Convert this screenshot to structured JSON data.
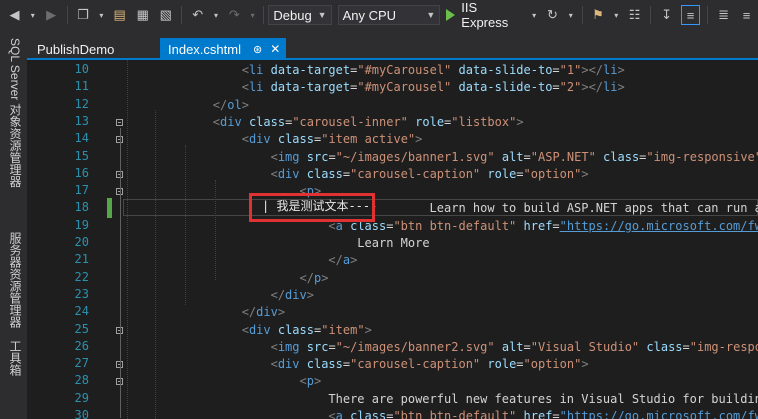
{
  "toolbar": {
    "config": "Debug",
    "platform": "Any CPU",
    "run_label": "IIS Express"
  },
  "sidebar": {
    "tabs": [
      "SQL Server 对象资源管理器",
      "服务器资源管理器",
      "工具箱"
    ]
  },
  "tabs": [
    {
      "label": "PublishDemo",
      "active": false
    },
    {
      "label": "Index.cshtml",
      "active": true
    }
  ],
  "editor": {
    "line_numbers": [
      "10",
      "11",
      "12",
      "13",
      "14",
      "15",
      "16",
      "17",
      "18",
      "19",
      "20",
      "21",
      "22",
      "23",
      "24",
      "25",
      "26",
      "27",
      "28",
      "29",
      "30"
    ],
    "lines": [
      {
        "indent": "            ",
        "tokens": [
          [
            "t-bracket",
            "<"
          ],
          [
            "t-tag",
            "li"
          ],
          [
            "t-text",
            " "
          ],
          [
            "t-attr",
            "data-target"
          ],
          [
            "t-text",
            "="
          ],
          [
            "t-str",
            "\"#myCarousel\""
          ],
          [
            "t-text",
            " "
          ],
          [
            "t-attr",
            "data-slide-to"
          ],
          [
            "t-text",
            "="
          ],
          [
            "t-str",
            "\"1\""
          ],
          [
            "t-bracket",
            "></"
          ],
          [
            "t-tag",
            "li"
          ],
          [
            "t-bracket",
            ">"
          ]
        ]
      },
      {
        "indent": "            ",
        "tokens": [
          [
            "t-bracket",
            "<"
          ],
          [
            "t-tag",
            "li"
          ],
          [
            "t-text",
            " "
          ],
          [
            "t-attr",
            "data-target"
          ],
          [
            "t-text",
            "="
          ],
          [
            "t-str",
            "\"#myCarousel\""
          ],
          [
            "t-text",
            " "
          ],
          [
            "t-attr",
            "data-slide-to"
          ],
          [
            "t-text",
            "="
          ],
          [
            "t-str",
            "\"2\""
          ],
          [
            "t-bracket",
            "></"
          ],
          [
            "t-tag",
            "li"
          ],
          [
            "t-bracket",
            ">"
          ]
        ]
      },
      {
        "indent": "        ",
        "tokens": [
          [
            "t-bracket",
            "</"
          ],
          [
            "t-tag",
            "ol"
          ],
          [
            "t-bracket",
            ">"
          ]
        ]
      },
      {
        "indent": "        ",
        "tokens": [
          [
            "t-bracket",
            "<"
          ],
          [
            "t-tag",
            "div"
          ],
          [
            "t-text",
            " "
          ],
          [
            "t-attr",
            "class"
          ],
          [
            "t-text",
            "="
          ],
          [
            "t-str",
            "\"carousel-inner\""
          ],
          [
            "t-text",
            " "
          ],
          [
            "t-attr",
            "role"
          ],
          [
            "t-text",
            "="
          ],
          [
            "t-str",
            "\"listbox\""
          ],
          [
            "t-bracket",
            ">"
          ]
        ]
      },
      {
        "indent": "            ",
        "tokens": [
          [
            "t-bracket",
            "<"
          ],
          [
            "t-tag",
            "div"
          ],
          [
            "t-text",
            " "
          ],
          [
            "t-attr",
            "class"
          ],
          [
            "t-text",
            "="
          ],
          [
            "t-str",
            "\"item active\""
          ],
          [
            "t-bracket",
            ">"
          ]
        ]
      },
      {
        "indent": "                ",
        "tokens": [
          [
            "t-bracket",
            "<"
          ],
          [
            "t-tag",
            "img"
          ],
          [
            "t-text",
            " "
          ],
          [
            "t-attr",
            "src"
          ],
          [
            "t-text",
            "="
          ],
          [
            "t-str",
            "\"~/images/banner1.svg\""
          ],
          [
            "t-text",
            " "
          ],
          [
            "t-attr",
            "alt"
          ],
          [
            "t-text",
            "="
          ],
          [
            "t-str",
            "\"ASP.NET\""
          ],
          [
            "t-text",
            " "
          ],
          [
            "t-attr",
            "class"
          ],
          [
            "t-text",
            "="
          ],
          [
            "t-str",
            "\"img-responsive\""
          ],
          [
            "t-text",
            " "
          ],
          [
            "t-bracket",
            "/>"
          ]
        ]
      },
      {
        "indent": "                ",
        "tokens": [
          [
            "t-bracket",
            "<"
          ],
          [
            "t-tag",
            "div"
          ],
          [
            "t-text",
            " "
          ],
          [
            "t-attr",
            "class"
          ],
          [
            "t-text",
            "="
          ],
          [
            "t-str",
            "\"carousel-caption\""
          ],
          [
            "t-text",
            " "
          ],
          [
            "t-attr",
            "role"
          ],
          [
            "t-text",
            "="
          ],
          [
            "t-str",
            "\"option\""
          ],
          [
            "t-bracket",
            ">"
          ]
        ]
      },
      {
        "indent": "                    ",
        "tokens": [
          [
            "t-bracket",
            "<"
          ],
          [
            "t-tag",
            "p"
          ],
          [
            "t-bracket",
            ">"
          ]
        ]
      },
      {
        "indent": "                                      ",
        "tokens": [
          [
            "t-text",
            "Learn how to build ASP.NET apps that can run any"
          ]
        ]
      },
      {
        "indent": "                        ",
        "tokens": [
          [
            "t-bracket",
            "<"
          ],
          [
            "t-tag",
            "a"
          ],
          [
            "t-text",
            " "
          ],
          [
            "t-attr",
            "class"
          ],
          [
            "t-text",
            "="
          ],
          [
            "t-str",
            "\"btn btn-default\""
          ],
          [
            "t-text",
            " "
          ],
          [
            "t-attr",
            "href"
          ],
          [
            "t-text",
            "="
          ],
          [
            "t-link",
            "\"https://go.microsoft.com/fwlink/?L"
          ]
        ]
      },
      {
        "indent": "                            ",
        "tokens": [
          [
            "t-text",
            "Learn More"
          ]
        ]
      },
      {
        "indent": "                        ",
        "tokens": [
          [
            "t-bracket",
            "</"
          ],
          [
            "t-tag",
            "a"
          ],
          [
            "t-bracket",
            ">"
          ]
        ]
      },
      {
        "indent": "                    ",
        "tokens": [
          [
            "t-bracket",
            "</"
          ],
          [
            "t-tag",
            "p"
          ],
          [
            "t-bracket",
            ">"
          ]
        ]
      },
      {
        "indent": "                ",
        "tokens": [
          [
            "t-bracket",
            "</"
          ],
          [
            "t-tag",
            "div"
          ],
          [
            "t-bracket",
            ">"
          ]
        ]
      },
      {
        "indent": "            ",
        "tokens": [
          [
            "t-bracket",
            "</"
          ],
          [
            "t-tag",
            "div"
          ],
          [
            "t-bracket",
            ">"
          ]
        ]
      },
      {
        "indent": "            ",
        "tokens": [
          [
            "t-bracket",
            "<"
          ],
          [
            "t-tag",
            "div"
          ],
          [
            "t-text",
            " "
          ],
          [
            "t-attr",
            "class"
          ],
          [
            "t-text",
            "="
          ],
          [
            "t-str",
            "\"item\""
          ],
          [
            "t-bracket",
            ">"
          ]
        ]
      },
      {
        "indent": "                ",
        "tokens": [
          [
            "t-bracket",
            "<"
          ],
          [
            "t-tag",
            "img"
          ],
          [
            "t-text",
            " "
          ],
          [
            "t-attr",
            "src"
          ],
          [
            "t-text",
            "="
          ],
          [
            "t-str",
            "\"~/images/banner2.svg\""
          ],
          [
            "t-text",
            " "
          ],
          [
            "t-attr",
            "alt"
          ],
          [
            "t-text",
            "="
          ],
          [
            "t-str",
            "\"Visual Studio\""
          ],
          [
            "t-text",
            " "
          ],
          [
            "t-attr",
            "class"
          ],
          [
            "t-text",
            "="
          ],
          [
            "t-str",
            "\"img-responsive\""
          ]
        ]
      },
      {
        "indent": "                ",
        "tokens": [
          [
            "t-bracket",
            "<"
          ],
          [
            "t-tag",
            "div"
          ],
          [
            "t-text",
            " "
          ],
          [
            "t-attr",
            "class"
          ],
          [
            "t-text",
            "="
          ],
          [
            "t-str",
            "\"carousel-caption\""
          ],
          [
            "t-text",
            " "
          ],
          [
            "t-attr",
            "role"
          ],
          [
            "t-text",
            "="
          ],
          [
            "t-str",
            "\"option\""
          ],
          [
            "t-bracket",
            ">"
          ]
        ]
      },
      {
        "indent": "                    ",
        "tokens": [
          [
            "t-bracket",
            "<"
          ],
          [
            "t-tag",
            "p"
          ],
          [
            "t-bracket",
            ">"
          ]
        ]
      },
      {
        "indent": "                        ",
        "tokens": [
          [
            "t-text",
            "There are powerful new features in Visual Studio for building moder"
          ]
        ]
      },
      {
        "indent": "                        ",
        "tokens": [
          [
            "t-bracket",
            "<"
          ],
          [
            "t-tag",
            "a"
          ],
          [
            "t-text",
            " "
          ],
          [
            "t-attr",
            "class"
          ],
          [
            "t-text",
            "="
          ],
          [
            "t-str",
            "\"btn btn-default\""
          ],
          [
            "t-text",
            " "
          ],
          [
            "t-attr",
            "href"
          ],
          [
            "t-text",
            "="
          ],
          [
            "t-link",
            "\"https://go.microsoft.com/fwlink/?L"
          ]
        ]
      }
    ],
    "inserted_text": "| 我是测试文本----"
  }
}
